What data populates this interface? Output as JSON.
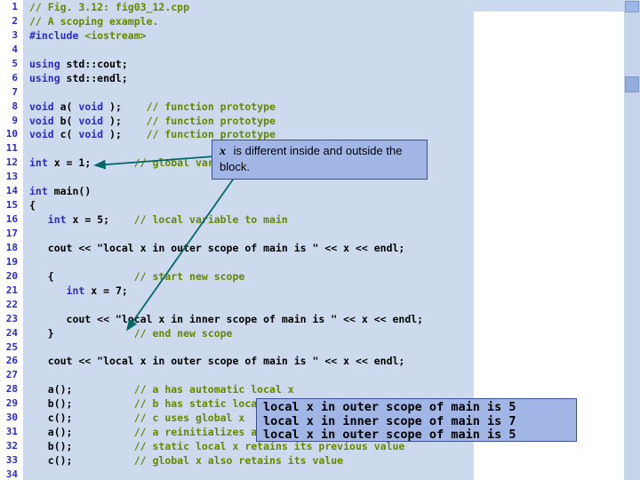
{
  "colors": {
    "code_bg": "#cdd9ec",
    "gutter_bg": "#ffffff",
    "keyword_blue": "#2a2ad0",
    "comment_green": "#668800",
    "plain_text": "#000000",
    "line_number_blue": "#2a2ad0",
    "box_bg": "#a2b6e6",
    "box_border": "#3c4f92",
    "arrow_teal": "#006868",
    "scrollbar_bg": "#c6d4ec",
    "scrollbar_thumb": "#93aedd"
  },
  "callout": {
    "var": "x",
    "rest": " is different inside and outside the block."
  },
  "output_box": {
    "lines": [
      "local x in outer scope of main is 5",
      "local x in inner scope of main is 7",
      "local x in outer scope of main is 5"
    ]
  },
  "code": {
    "lines": [
      {
        "n": "1",
        "segs": [
          {
            "t": "// Fig. 3.12: fig03_12.cpp",
            "c": "c"
          }
        ]
      },
      {
        "n": "2",
        "segs": [
          {
            "t": "// A scoping example.",
            "c": "c"
          }
        ]
      },
      {
        "n": "3",
        "segs": [
          {
            "t": "#include ",
            "c": "k"
          },
          {
            "t": "<iostream>",
            "c": "c"
          }
        ]
      },
      {
        "n": "4",
        "segs": []
      },
      {
        "n": "5",
        "segs": [
          {
            "t": "using ",
            "c": "k"
          },
          {
            "t": "std::cout;",
            "c": "p"
          }
        ]
      },
      {
        "n": "6",
        "segs": [
          {
            "t": "using ",
            "c": "k"
          },
          {
            "t": "std::endl;",
            "c": "p"
          }
        ]
      },
      {
        "n": "7",
        "segs": []
      },
      {
        "n": "8",
        "segs": [
          {
            "t": "void ",
            "c": "k"
          },
          {
            "t": "a( ",
            "c": "p"
          },
          {
            "t": "void",
            "c": "k"
          },
          {
            "t": " );    ",
            "c": "p"
          },
          {
            "t": "// function prototype",
            "c": "c"
          }
        ]
      },
      {
        "n": "9",
        "segs": [
          {
            "t": "void ",
            "c": "k"
          },
          {
            "t": "b( ",
            "c": "p"
          },
          {
            "t": "void",
            "c": "k"
          },
          {
            "t": " );    ",
            "c": "p"
          },
          {
            "t": "// function prototype",
            "c": "c"
          }
        ]
      },
      {
        "n": "10",
        "segs": [
          {
            "t": "void ",
            "c": "k"
          },
          {
            "t": "c( ",
            "c": "p"
          },
          {
            "t": "void",
            "c": "k"
          },
          {
            "t": " );    ",
            "c": "p"
          },
          {
            "t": "// function prototype",
            "c": "c"
          }
        ]
      },
      {
        "n": "11",
        "segs": []
      },
      {
        "n": "12",
        "segs": [
          {
            "t": "int ",
            "c": "k"
          },
          {
            "t": "x = 1;       ",
            "c": "p"
          },
          {
            "t": "// global variable",
            "c": "c"
          }
        ]
      },
      {
        "n": "13",
        "segs": []
      },
      {
        "n": "14",
        "segs": [
          {
            "t": "int ",
            "c": "k"
          },
          {
            "t": "main()",
            "c": "p"
          }
        ]
      },
      {
        "n": "15",
        "segs": [
          {
            "t": "{",
            "c": "p"
          }
        ]
      },
      {
        "n": "16",
        "segs": [
          {
            "t": "   ",
            "c": "p"
          },
          {
            "t": "int ",
            "c": "k"
          },
          {
            "t": "x = 5;    ",
            "c": "p"
          },
          {
            "t": "// local variable to main",
            "c": "c"
          }
        ]
      },
      {
        "n": "17",
        "segs": []
      },
      {
        "n": "18",
        "segs": [
          {
            "t": "   cout << \"local x in outer scope of main is \" << x << endl;",
            "c": "p"
          }
        ]
      },
      {
        "n": "19",
        "segs": []
      },
      {
        "n": "20",
        "segs": [
          {
            "t": "   {             ",
            "c": "p"
          },
          {
            "t": "// start new scope",
            "c": "c"
          }
        ]
      },
      {
        "n": "21",
        "segs": [
          {
            "t": "      ",
            "c": "p"
          },
          {
            "t": "int ",
            "c": "k"
          },
          {
            "t": "x = 7;",
            "c": "p"
          }
        ]
      },
      {
        "n": "22",
        "segs": []
      },
      {
        "n": "23",
        "segs": [
          {
            "t": "      cout << \"local x in inner scope of main is \" << x << endl;",
            "c": "p"
          }
        ]
      },
      {
        "n": "24",
        "segs": [
          {
            "t": "   }             ",
            "c": "p"
          },
          {
            "t": "// end new scope",
            "c": "c"
          }
        ]
      },
      {
        "n": "25",
        "segs": []
      },
      {
        "n": "26",
        "segs": [
          {
            "t": "   cout << \"local x in outer scope of main is \" << x << endl;",
            "c": "p"
          }
        ]
      },
      {
        "n": "27",
        "segs": []
      },
      {
        "n": "28",
        "segs": [
          {
            "t": "   a();          ",
            "c": "p"
          },
          {
            "t": "// a has automatic local x",
            "c": "c"
          }
        ]
      },
      {
        "n": "29",
        "segs": [
          {
            "t": "   b();          ",
            "c": "p"
          },
          {
            "t": "// b has static local x",
            "c": "c"
          }
        ]
      },
      {
        "n": "30",
        "segs": [
          {
            "t": "   c();          ",
            "c": "p"
          },
          {
            "t": "// c uses global x",
            "c": "c"
          }
        ]
      },
      {
        "n": "31",
        "segs": [
          {
            "t": "   a();          ",
            "c": "p"
          },
          {
            "t": "// a reinitializes automatic local x",
            "c": "c"
          }
        ]
      },
      {
        "n": "32",
        "segs": [
          {
            "t": "   b();          ",
            "c": "p"
          },
          {
            "t": "// static local x retains its previous value",
            "c": "c"
          }
        ]
      },
      {
        "n": "33",
        "segs": [
          {
            "t": "   c();          ",
            "c": "p"
          },
          {
            "t": "// global x also retains its value",
            "c": "c"
          }
        ]
      },
      {
        "n": "34",
        "segs": []
      }
    ]
  }
}
